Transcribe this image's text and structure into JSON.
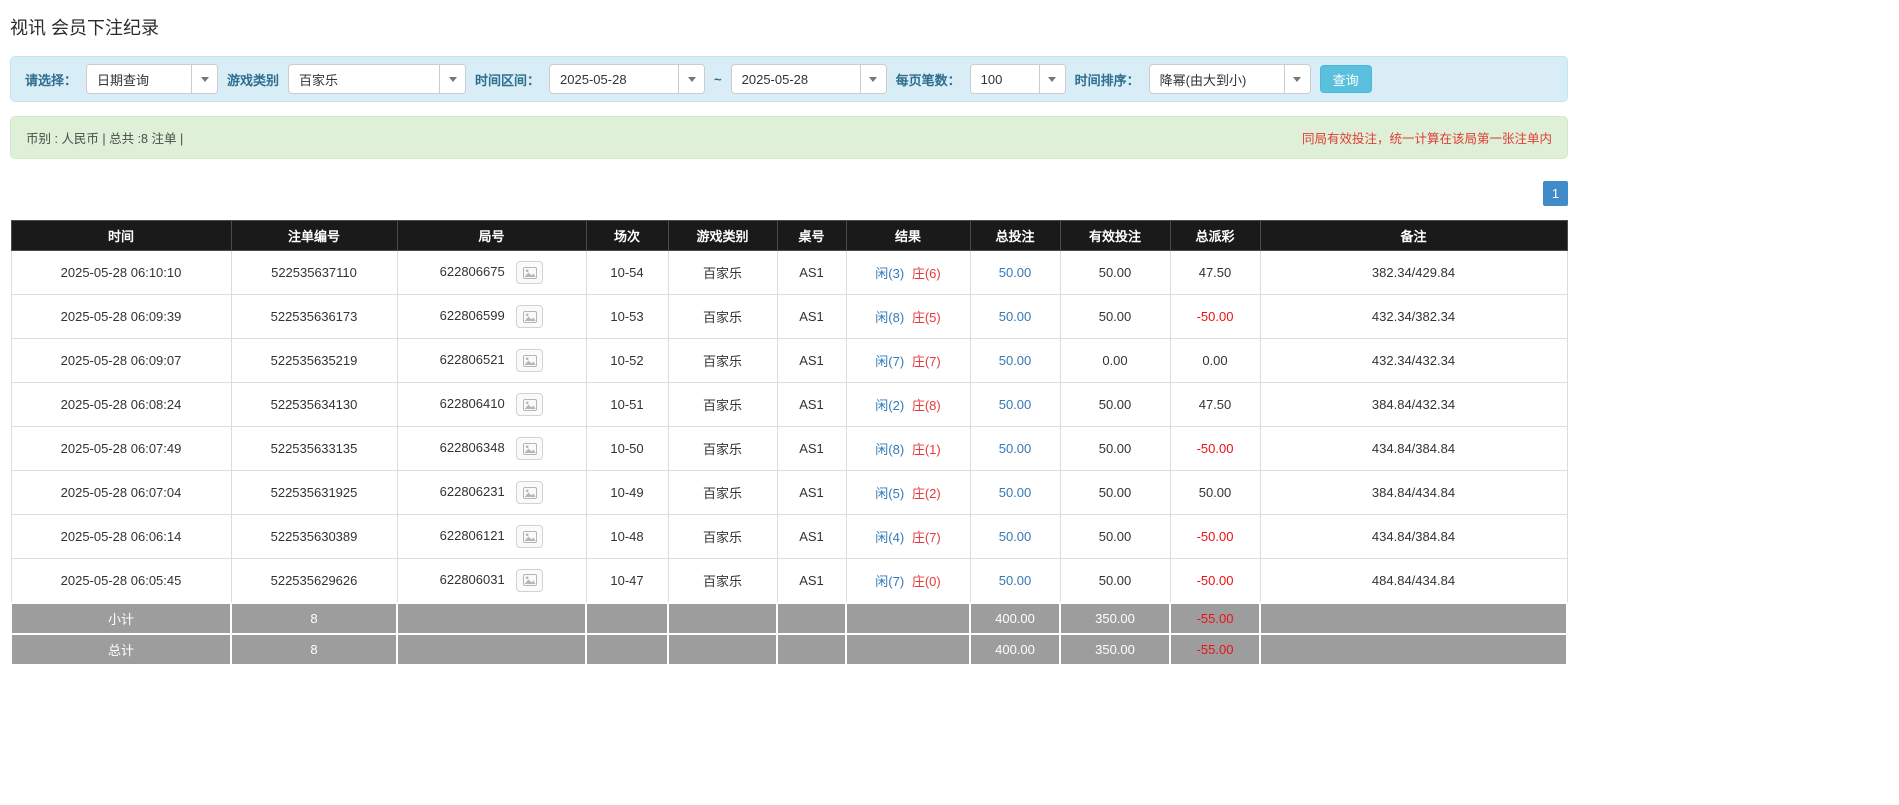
{
  "page": {
    "title": "视讯 会员下注纪录"
  },
  "colors": {
    "accent_blue": "#337ab7",
    "player_blue": "#337ab7",
    "banker_red": "#e4393c",
    "negative_red": "#ee1111",
    "filter_bar_bg": "#d9edf7",
    "summary_bar_bg": "#dff0d8",
    "table_header_bg": "#1a1a1a",
    "table_footer_bg": "#9d9d9d",
    "search_button_bg": "#5bc0de",
    "pagination_active_bg": "#428bca"
  },
  "filters": {
    "select_label": "请选择：",
    "query_type": "日期查询",
    "game_type_label": "游戏类别",
    "game_type": "百家乐",
    "date_range_label": "时间区间：",
    "date_from": "2025-05-28",
    "range_separator": "~",
    "date_to": "2025-05-28",
    "page_size_label": "每页笔数：",
    "page_size": "100",
    "sort_label": "时间排序：",
    "sort_order": "降幂(由大到小)",
    "search_button": "查询"
  },
  "summary": {
    "left_text": "币别 : 人民币 | 总共 :8 注单 |",
    "right_text": "同局有效投注，统一计算在该局第一张注单内"
  },
  "pagination": {
    "current_page": "1"
  },
  "table": {
    "headers": [
      "时间",
      "注单编号",
      "局号",
      "场次",
      "游戏类别",
      "桌号",
      "结果",
      "总投注",
      "有效投注",
      "总派彩",
      "备注"
    ],
    "rows": [
      {
        "time": "2025-05-28 06:10:10",
        "bet_id": "522535637110",
        "round_id": "622806675",
        "session": "10-54",
        "game_type": "百家乐",
        "table_id": "AS1",
        "result_player": "闲(3)",
        "result_banker": "庄(6)",
        "total_bet": "50.00",
        "valid_bet": "50.00",
        "payout": "47.50",
        "note": "382.34/429.84"
      },
      {
        "time": "2025-05-28 06:09:39",
        "bet_id": "522535636173",
        "round_id": "622806599",
        "session": "10-53",
        "game_type": "百家乐",
        "table_id": "AS1",
        "result_player": "闲(8)",
        "result_banker": "庄(5)",
        "total_bet": "50.00",
        "valid_bet": "50.00",
        "payout": "-50.00",
        "note": "432.34/382.34"
      },
      {
        "time": "2025-05-28 06:09:07",
        "bet_id": "522535635219",
        "round_id": "622806521",
        "session": "10-52",
        "game_type": "百家乐",
        "table_id": "AS1",
        "result_player": "闲(7)",
        "result_banker": "庄(7)",
        "total_bet": "50.00",
        "valid_bet": "0.00",
        "payout": "0.00",
        "note": "432.34/432.34"
      },
      {
        "time": "2025-05-28 06:08:24",
        "bet_id": "522535634130",
        "round_id": "622806410",
        "session": "10-51",
        "game_type": "百家乐",
        "table_id": "AS1",
        "result_player": "闲(2)",
        "result_banker": "庄(8)",
        "total_bet": "50.00",
        "valid_bet": "50.00",
        "payout": "47.50",
        "note": "384.84/432.34"
      },
      {
        "time": "2025-05-28 06:07:49",
        "bet_id": "522535633135",
        "round_id": "622806348",
        "session": "10-50",
        "game_type": "百家乐",
        "table_id": "AS1",
        "result_player": "闲(8)",
        "result_banker": "庄(1)",
        "total_bet": "50.00",
        "valid_bet": "50.00",
        "payout": "-50.00",
        "note": "434.84/384.84"
      },
      {
        "time": "2025-05-28 06:07:04",
        "bet_id": "522535631925",
        "round_id": "622806231",
        "session": "10-49",
        "game_type": "百家乐",
        "table_id": "AS1",
        "result_player": "闲(5)",
        "result_banker": "庄(2)",
        "total_bet": "50.00",
        "valid_bet": "50.00",
        "payout": "50.00",
        "note": "384.84/434.84"
      },
      {
        "time": "2025-05-28 06:06:14",
        "bet_id": "522535630389",
        "round_id": "622806121",
        "session": "10-48",
        "game_type": "百家乐",
        "table_id": "AS1",
        "result_player": "闲(4)",
        "result_banker": "庄(7)",
        "total_bet": "50.00",
        "valid_bet": "50.00",
        "payout": "-50.00",
        "note": "434.84/384.84"
      },
      {
        "time": "2025-05-28 06:05:45",
        "bet_id": "522535629626",
        "round_id": "622806031",
        "session": "10-47",
        "game_type": "百家乐",
        "table_id": "AS1",
        "result_player": "闲(7)",
        "result_banker": "庄(0)",
        "total_bet": "50.00",
        "valid_bet": "50.00",
        "payout": "-50.00",
        "note": "484.84/434.84"
      }
    ],
    "subtotal": {
      "label": "小计",
      "count": "8",
      "total_bet": "400.00",
      "valid_bet": "350.00",
      "payout": "-55.00"
    },
    "total": {
      "label": "总计",
      "count": "8",
      "total_bet": "400.00",
      "valid_bet": "350.00",
      "payout": "-55.00"
    }
  }
}
